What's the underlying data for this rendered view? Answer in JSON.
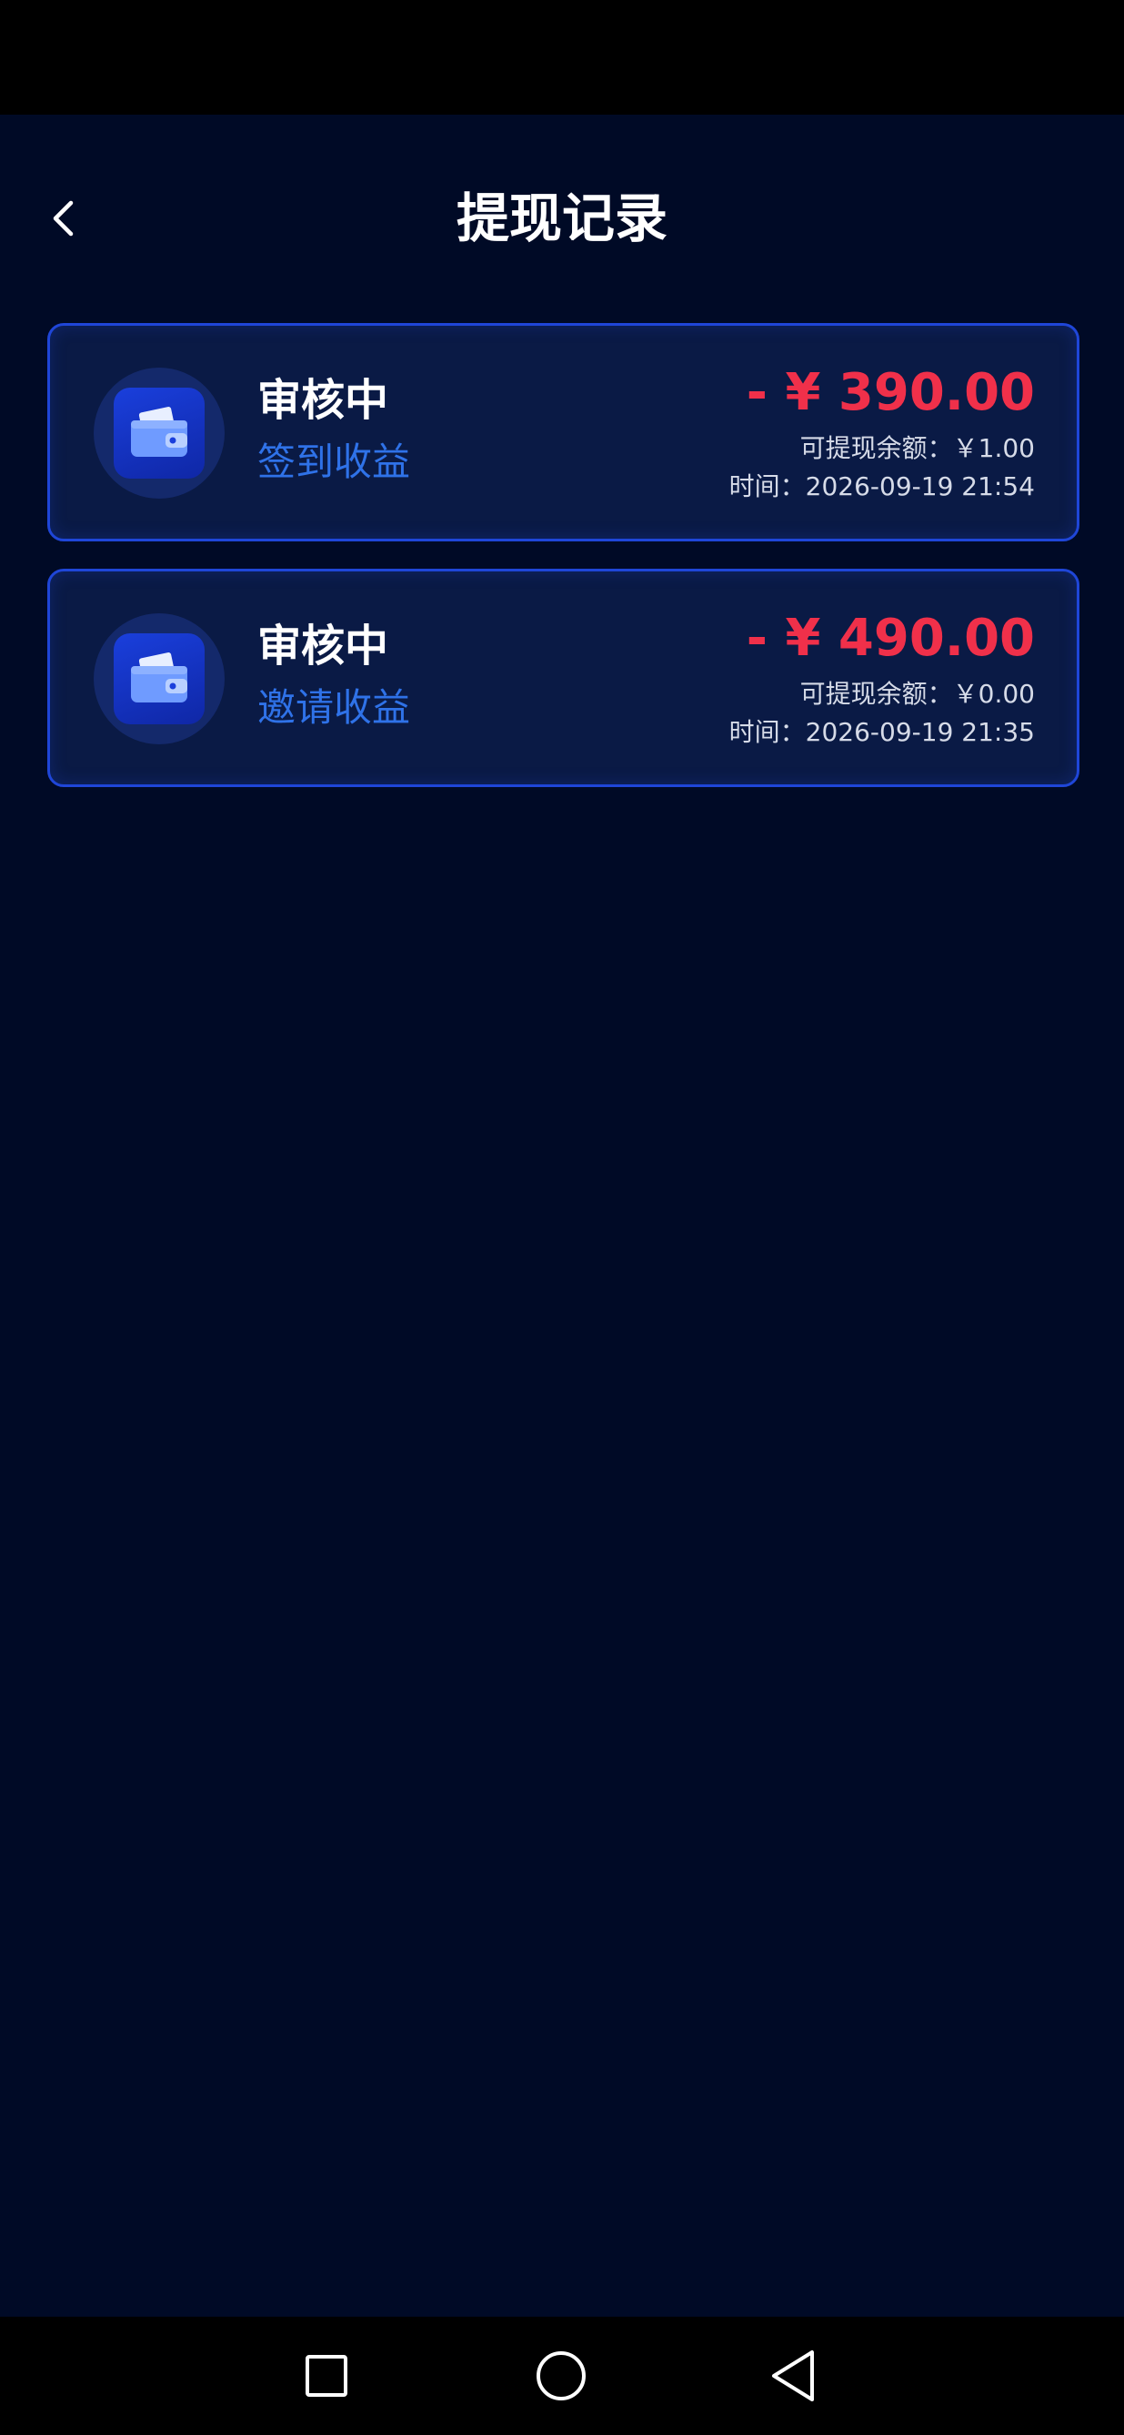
{
  "header": {
    "title": "提现记录"
  },
  "records": [
    {
      "status": "审核中",
      "type": "签到收益",
      "amount": "- ¥ 390.00",
      "balance": "可提现余额：￥1.00",
      "time": "时间：2026-09-19 21:54"
    },
    {
      "status": "审核中",
      "type": "邀请收益",
      "amount": "- ¥ 490.00",
      "balance": "可提现余额：￥0.00",
      "time": "时间：2026-09-19 21:35"
    }
  ],
  "icons": {
    "back": "chevron-left-icon",
    "record": "wallet-icon",
    "nav_recent": "square-icon",
    "nav_home": "circle-icon",
    "nav_back": "triangle-back-icon"
  },
  "colors": {
    "background": "#000a26",
    "card_bg": "#0a1a45",
    "card_border": "#1f46d8",
    "amount": "#f0304a",
    "type_text": "#2f72e8"
  }
}
